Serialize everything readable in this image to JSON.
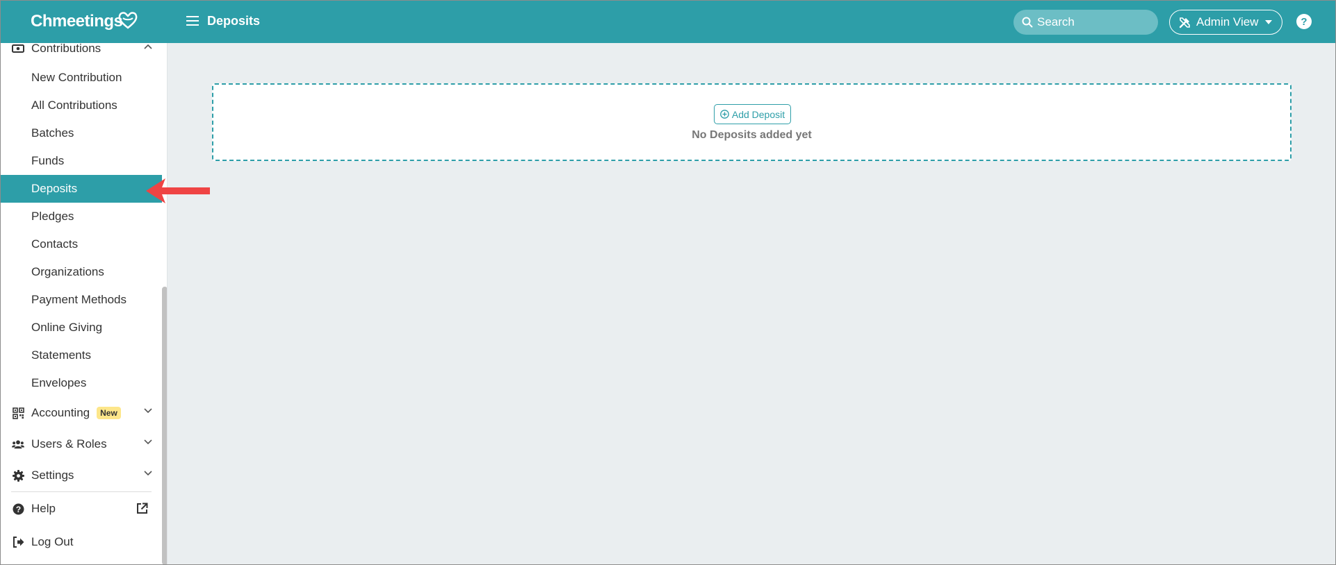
{
  "app": {
    "logo_text": "Chmeetings"
  },
  "header": {
    "page_title": "Deposits",
    "search_placeholder": "Search",
    "admin_view_label": "Admin View"
  },
  "sidebar": {
    "contributions_label": "Contributions",
    "sub_items": [
      {
        "label": "New Contribution"
      },
      {
        "label": "All Contributions"
      },
      {
        "label": "Batches"
      },
      {
        "label": "Funds"
      },
      {
        "label": "Deposits",
        "active": true
      },
      {
        "label": "Pledges"
      },
      {
        "label": "Contacts"
      },
      {
        "label": "Organizations"
      },
      {
        "label": "Payment Methods"
      },
      {
        "label": "Online Giving"
      },
      {
        "label": "Statements"
      },
      {
        "label": "Envelopes"
      }
    ],
    "accounting_label": "Accounting",
    "accounting_badge": "New",
    "users_roles_label": "Users & Roles",
    "settings_label": "Settings",
    "help_label": "Help",
    "logout_label": "Log Out"
  },
  "main": {
    "add_deposit_label": "Add Deposit",
    "empty_message": "No Deposits added yet"
  },
  "colors": {
    "accent": "#2d9ea8",
    "background": "#eaeef0",
    "badge": "#fde68a",
    "annotation_arrow": "#ef4444"
  }
}
